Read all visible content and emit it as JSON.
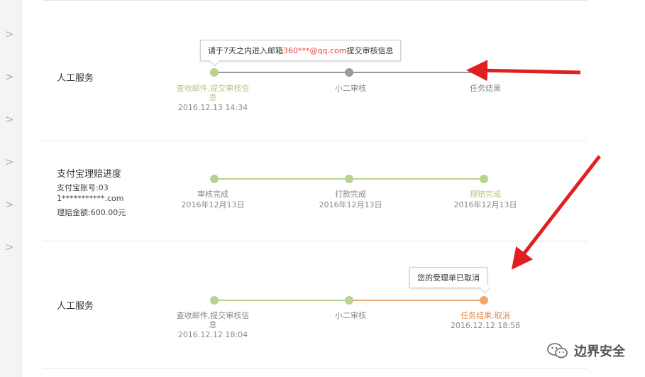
{
  "sidebar": {
    "chevrons": [
      ">",
      ">",
      ">",
      ">",
      ">",
      ">"
    ]
  },
  "row1": {
    "title": "人工服务",
    "tooltip": {
      "prefix": "请于7天之内进入邮箱",
      "email_red": "360***@qq.com",
      "suffix": "提交审核信息"
    },
    "steps": [
      {
        "label": "查收邮件,提交审核信息",
        "date": "2016.12.13 14:34"
      },
      {
        "label": "小二审核",
        "date": ""
      },
      {
        "label": "任务结果",
        "date": ""
      }
    ]
  },
  "row2": {
    "title": "支付宝理赔进度",
    "account_line1": "支付宝账号:03",
    "account_line2": "1***********.com",
    "amount": "理赔金额:600.00元",
    "steps": [
      {
        "label": "审核完成",
        "date": "2016年12月13日"
      },
      {
        "label": "打款完成",
        "date": "2016年12月13日"
      },
      {
        "label": "理赔完成",
        "date": "2016年12月13日"
      }
    ]
  },
  "row3": {
    "title": "人工服务",
    "tooltip": "您的受理单已取消",
    "steps": [
      {
        "label": "查收邮件,提交审核信息",
        "date": "2016.12.12 18:04"
      },
      {
        "label": "小二审核",
        "date": ""
      },
      {
        "label": "任务结果:取消",
        "date": "2016.12.12 18:58"
      }
    ]
  },
  "watermark": {
    "text": "边界安全"
  },
  "colors": {
    "green": "#b9d38d",
    "grey": "#9b9b9b",
    "orange": "#f0a871",
    "red_accent": "#e8423a",
    "arrow": "#e02020"
  }
}
